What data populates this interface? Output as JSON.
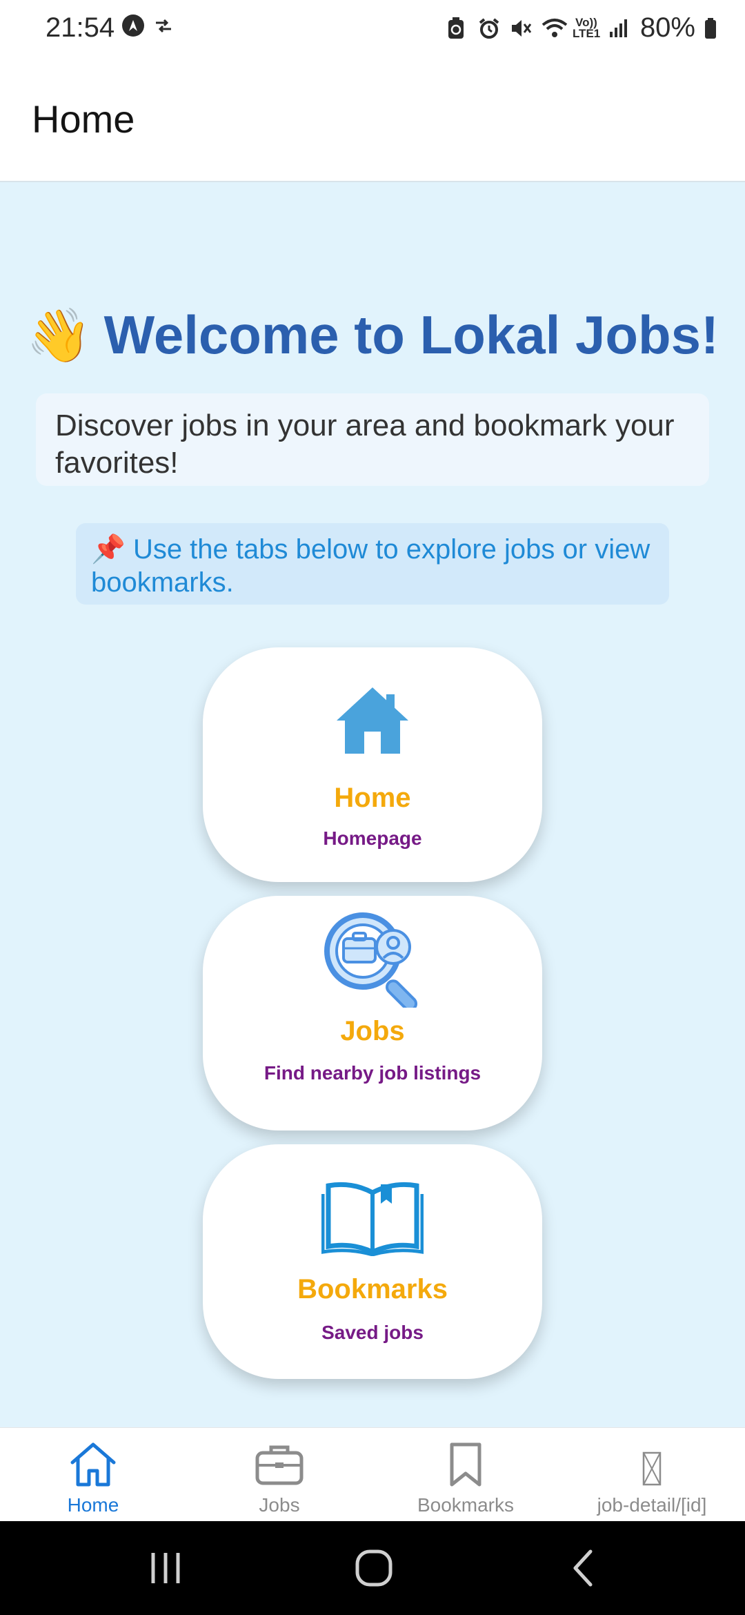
{
  "status_bar": {
    "time": "21:54",
    "battery": "80%",
    "volte_text": "Vo)) LTE1",
    "icons_left": [
      "navigation-app-icon",
      "data-transfer-icon"
    ],
    "icons_right": [
      "battery-saver-icon",
      "alarm-icon",
      "mute-icon",
      "wifi-icon",
      "volte-icon",
      "signal-icon",
      "battery-icon"
    ]
  },
  "header": {
    "title": "Home"
  },
  "main": {
    "welcome_emoji": "👋",
    "welcome_text": "Welcome to Lokal Jobs!",
    "discover_text": "Discover jobs in your area and bookmark your favorites!",
    "tip_emoji": "📌",
    "tip_text": "Use the tabs below to explore jobs or view bookmarks.",
    "cards": [
      {
        "title": "Home",
        "subtitle": "Homepage",
        "icon": "house-icon"
      },
      {
        "title": "Jobs",
        "subtitle": "Find nearby job listings",
        "icon": "job-search-icon"
      },
      {
        "title": "Bookmarks",
        "subtitle": "Saved jobs",
        "icon": "open-book-icon"
      }
    ]
  },
  "tabs": [
    {
      "label": "Home",
      "icon": "home-icon",
      "active": true
    },
    {
      "label": "Jobs",
      "icon": "briefcase-icon",
      "active": false
    },
    {
      "label": "Bookmarks",
      "icon": "bookmark-icon",
      "active": false
    },
    {
      "label": "job-detail/[id]",
      "icon": "missing-glyph-icon",
      "active": false
    }
  ],
  "colors": {
    "background": "#e1f3fc",
    "welcome": "#2b5fae",
    "tip_text": "#1f8ad6",
    "card_title": "#f4a90c",
    "card_subtitle": "#761a86",
    "tab_active": "#1a78d8",
    "tab_inactive": "#8c8c8c"
  }
}
